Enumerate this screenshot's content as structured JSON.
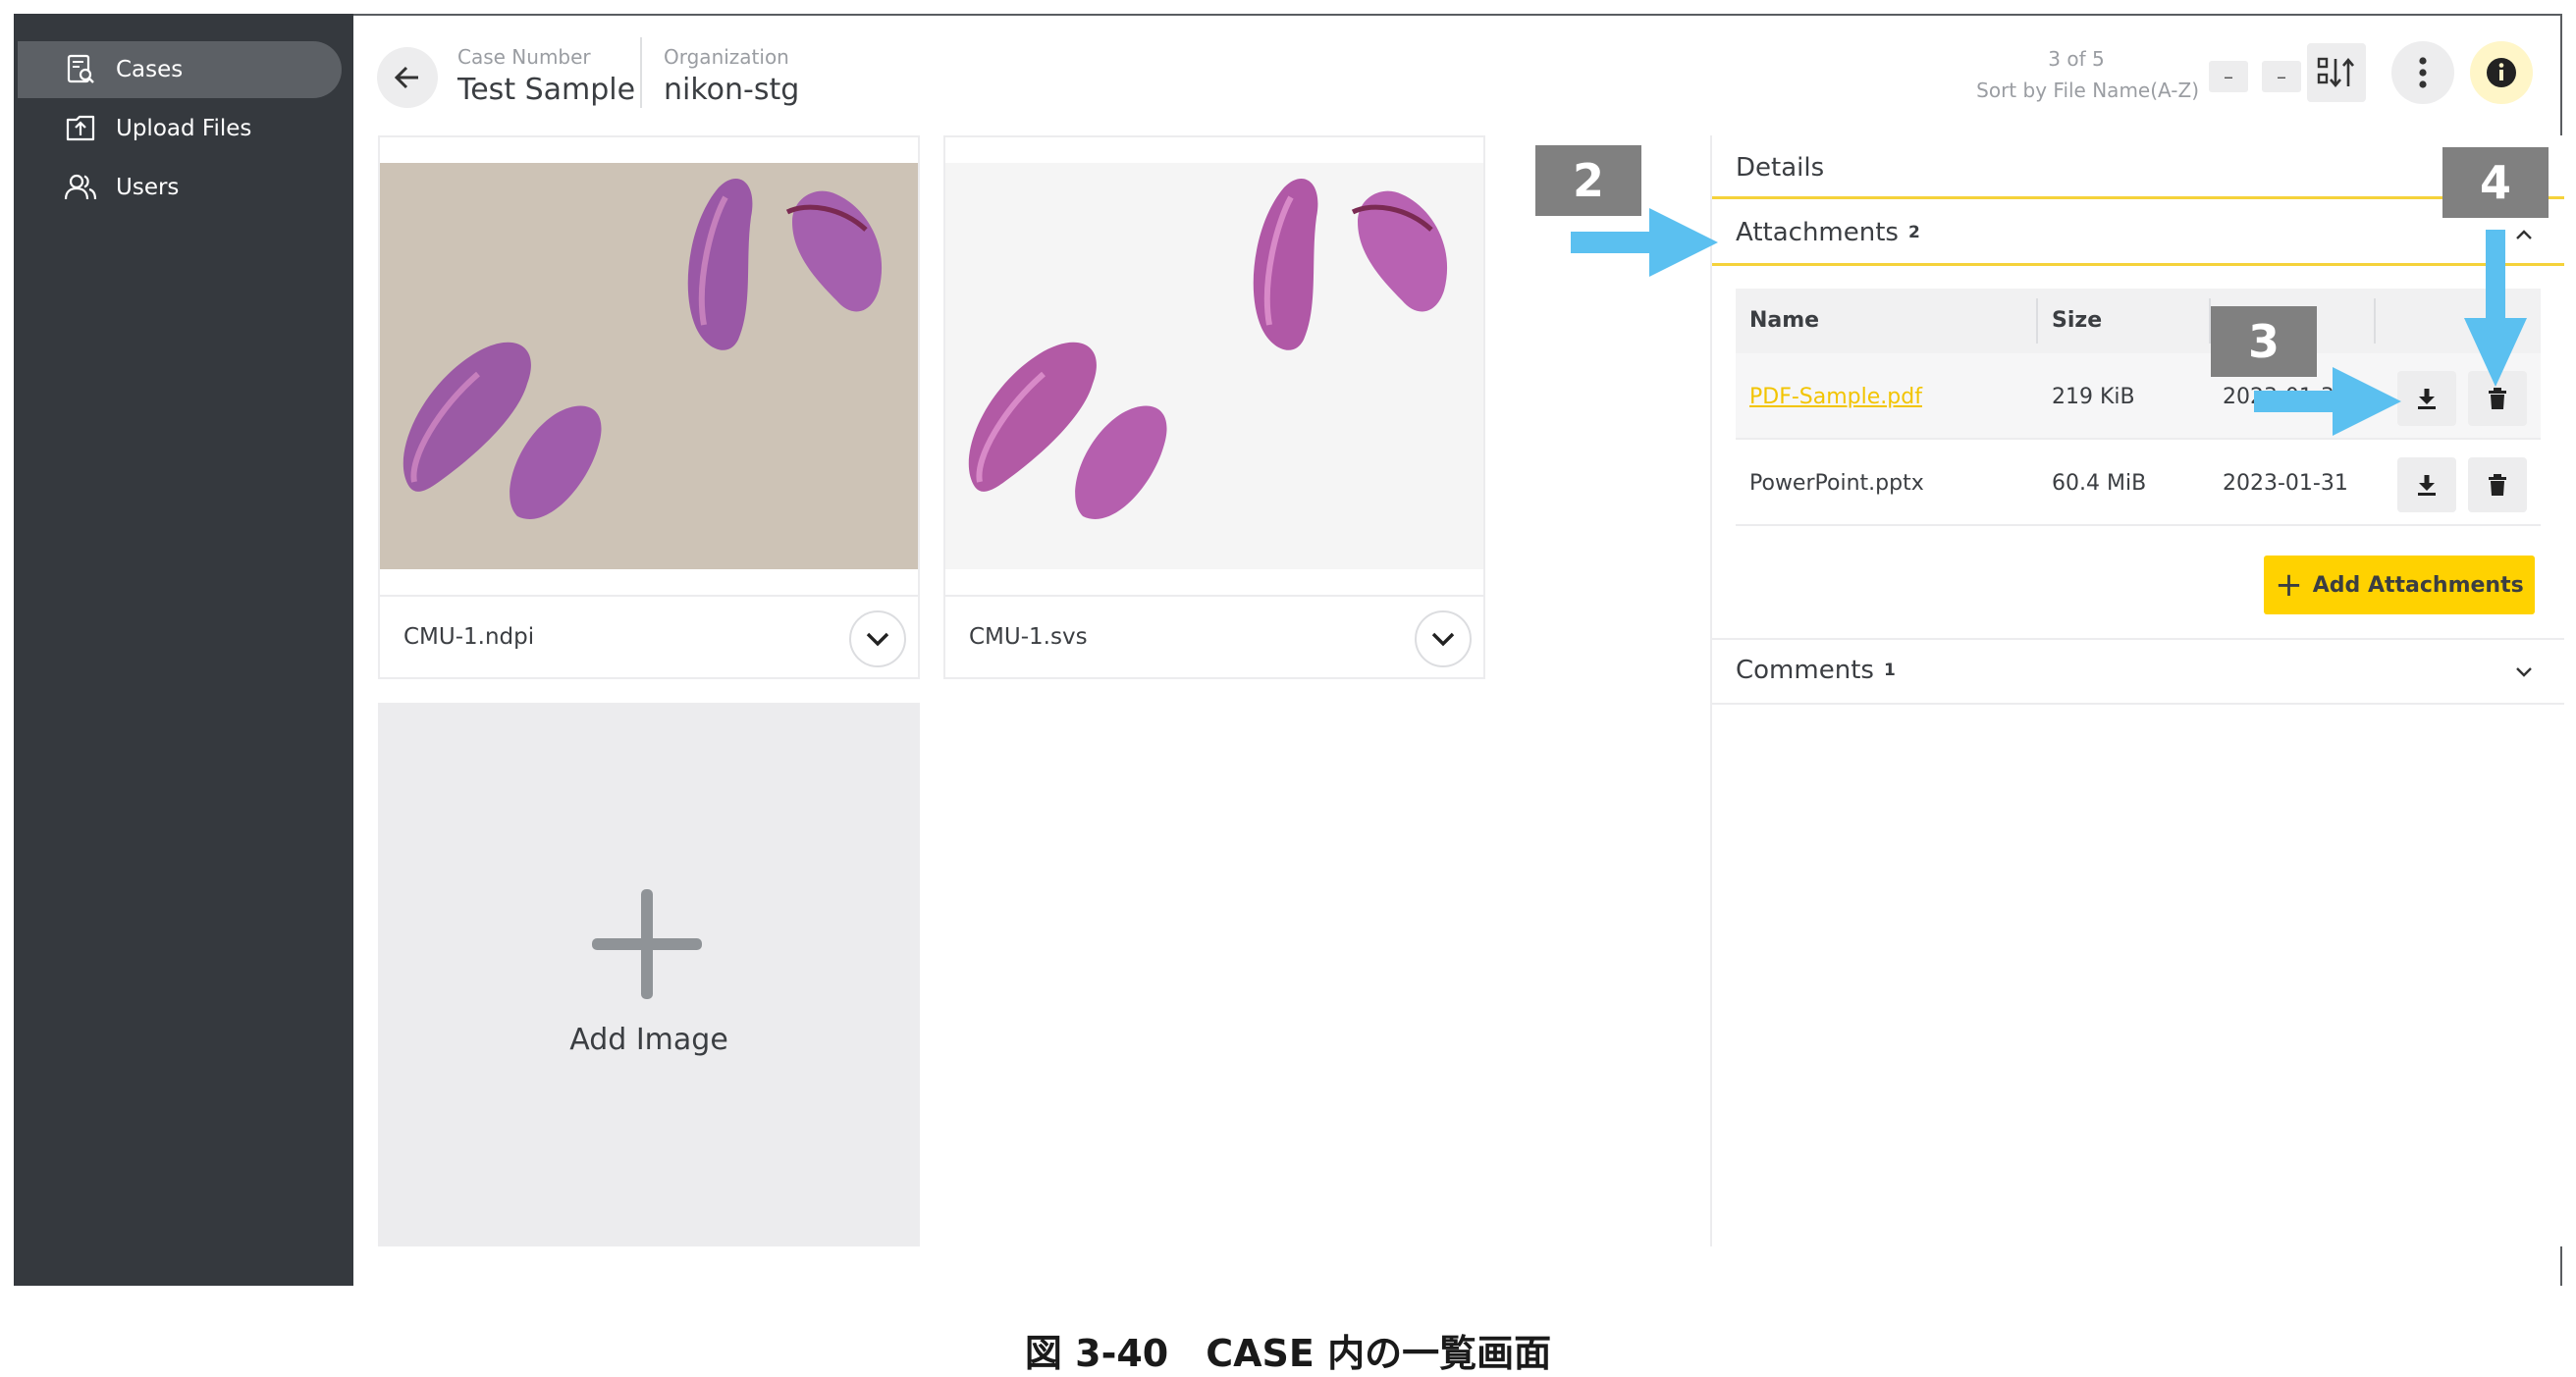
{
  "sidebar": {
    "items": [
      {
        "label": "Cases",
        "icon": "cases-icon",
        "active": true
      },
      {
        "label": "Upload Files",
        "icon": "upload-icon",
        "active": false
      },
      {
        "label": "Users",
        "icon": "users-icon",
        "active": false
      }
    ]
  },
  "header": {
    "case_number_label": "Case Number",
    "case_number_value": "Test Sample",
    "organization_label": "Organization",
    "organization_value": "nikon-stg",
    "pager_count": "3 of 5",
    "sort_label": "Sort by File Name(A-Z)",
    "prev_label": "–",
    "next_label": "–"
  },
  "images": [
    {
      "file_name": "CMU-1.ndpi"
    },
    {
      "file_name": "CMU-1.svs"
    }
  ],
  "add_image_label": "Add Image",
  "panel": {
    "details_label": "Details",
    "attachments_label": "Attachments",
    "attachments_count": "2",
    "comments_label": "Comments",
    "comments_count": "1",
    "table_headers": {
      "name": "Name",
      "size": "Size"
    },
    "rows": [
      {
        "name": "PDF-Sample.pdf",
        "size": "219 KiB",
        "date": "2023-01-31"
      },
      {
        "name": "PowerPoint.pptx",
        "size": "60.4 MiB",
        "date": "2023-01-31"
      }
    ],
    "add_attachments_label": "Add Attachments"
  },
  "annotations": {
    "badge_2": "2",
    "badge_3": "3",
    "badge_4": "4"
  },
  "caption": "図 3-40　CASE 内の一覧画面",
  "colors": {
    "sidebar_bg": "#35393e",
    "accent_yellow": "#ffd200",
    "annotation_arrow": "#5bc0f0",
    "annotation_badge": "#808080"
  }
}
